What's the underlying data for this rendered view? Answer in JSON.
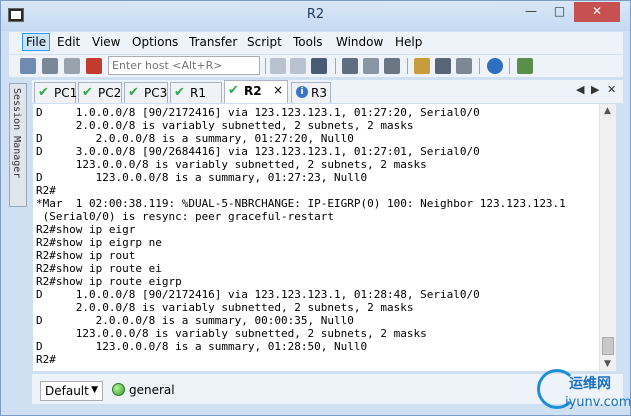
{
  "window": {
    "title": "R2",
    "controls": {
      "minimize": "—",
      "maximize": "□",
      "close": "✕"
    }
  },
  "menu": {
    "items": [
      "File",
      "Edit",
      "View",
      "Options",
      "Transfer",
      "Script",
      "Tools",
      "Window",
      "Help"
    ],
    "active": "File"
  },
  "toolbar": {
    "host_placeholder": "Enter host <Alt+R>",
    "icons": [
      "connect-icon",
      "quick-connect-icon",
      "reconnect-icon",
      "disconnect-icon",
      "copy-icon",
      "paste-icon",
      "find-icon",
      "print-icon",
      "print-setup-icon",
      "options-icon",
      "keymap-icon",
      "sftp-icon",
      "help-icon",
      "log-icon"
    ]
  },
  "session_manager": {
    "label": "Session Manager"
  },
  "tabs": [
    {
      "label": "PC1",
      "status": "connected"
    },
    {
      "label": "PC2",
      "status": "connected"
    },
    {
      "label": "PC3",
      "status": "connected"
    },
    {
      "label": "R1",
      "status": "connected"
    },
    {
      "label": "R2",
      "status": "connected",
      "active": true
    },
    {
      "label": "R3",
      "status": "info"
    }
  ],
  "tab_close": "×",
  "tab_nav": {
    "left": "◀",
    "right": "▶",
    "close": "✕"
  },
  "terminal": {
    "lines": [
      "D     1.0.0.0/8 [90/2172416] via 123.123.123.1, 01:27:20, Serial0/0",
      "      2.0.0.0/8 is variably subnetted, 2 subnets, 2 masks",
      "D        2.0.0.0/8 is a summary, 01:27:20, Null0",
      "D     3.0.0.0/8 [90/2684416] via 123.123.123.1, 01:27:01, Serial0/0",
      "      123.0.0.0/8 is variably subnetted, 2 subnets, 2 masks",
      "D        123.0.0.0/8 is a summary, 01:27:23, Null0",
      "R2#",
      "*Mar  1 02:00:38.119: %DUAL-5-NBRCHANGE: IP-EIGRP(0) 100: Neighbor 123.123.123.1",
      " (Serial0/0) is resync: peer graceful-restart",
      "R2#show ip eigr",
      "R2#show ip eigrp ne",
      "R2#show ip rout",
      "R2#show ip route ei",
      "R2#show ip route eigrp",
      "D     1.0.0.0/8 [90/2172416] via 123.123.123.1, 01:28:48, Serial0/0",
      "      2.0.0.0/8 is variably subnetted, 2 subnets, 2 masks",
      "D        2.0.0.0/8 is a summary, 00:00:35, Null0",
      "      123.0.0.0/8 is variably subnetted, 2 subnets, 2 masks",
      "D        123.0.0.0/8 is a summary, 01:28:50, Null0",
      "R2#"
    ]
  },
  "scrollbar": {
    "up": "▲",
    "down": "▼"
  },
  "bottom": {
    "button_bar": "Default",
    "dropdown_arrow": "▼",
    "status": "general"
  },
  "watermark": {
    "top": "运维网",
    "bottom": "iyunv.com"
  }
}
